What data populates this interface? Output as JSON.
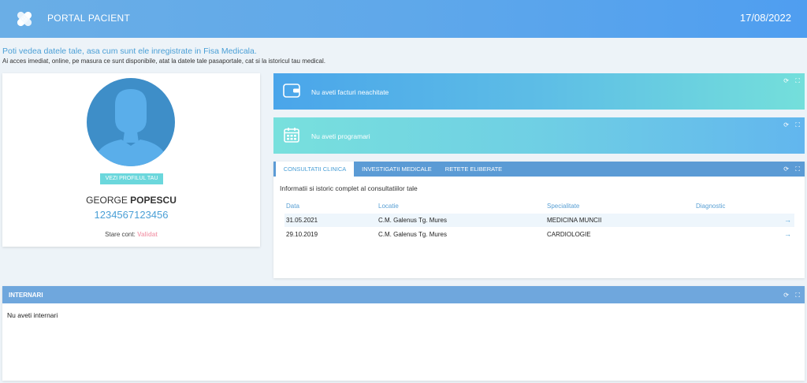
{
  "header": {
    "app_title": "PORTAL PACIENT",
    "date": "17/08/2022",
    "logo_icon": "bandage-icon"
  },
  "intro": {
    "title": "Poti vedea datele tale, asa cum sunt ele inregistrate in Fisa Medicala.",
    "subtitle": "Ai acces imediat, online, pe masura ce sunt disponibile, atat la datele tale pasaportale, cat si la istoricul tau medical."
  },
  "profile": {
    "button_label": "VEZI PROFILUL TAU",
    "first_name": "GEORGE",
    "last_name": "POPESCU",
    "patient_id": "1234567123456",
    "status_label": "Stare cont:",
    "status_value": "Validat"
  },
  "invoices": {
    "text": "Nu aveti facturi neachitate",
    "icon": "wallet-icon"
  },
  "appointments": {
    "text": "Nu aveti programari",
    "icon": "calendar-icon"
  },
  "consultations": {
    "tabs": [
      {
        "label": "CONSULTATII CLINICA",
        "active": true
      },
      {
        "label": "INVESTIGATII MEDICALE",
        "active": false
      },
      {
        "label": "RETETE ELIBERATE",
        "active": false
      }
    ],
    "intro": "Informatii si istoric complet al consultatiilor tale",
    "columns": [
      "Data",
      "Locatie",
      "Specialitate",
      "Diagnostic"
    ],
    "rows": [
      {
        "date": "31.05.2021",
        "location": "C.M. Galenus Tg. Mures",
        "specialty": "MEDICINA MUNCII",
        "diagnosis": ""
      },
      {
        "date": "29.10.2019",
        "location": "C.M. Galenus Tg. Mures",
        "specialty": "CARDIOLOGIE",
        "diagnosis": ""
      }
    ]
  },
  "admissions": {
    "title": "INTERNARI",
    "empty_text": "Nu aveti internari"
  },
  "colors": {
    "primary": "#5fa8ea",
    "accent": "#6bd7dc",
    "status": "#f4a4b4"
  }
}
